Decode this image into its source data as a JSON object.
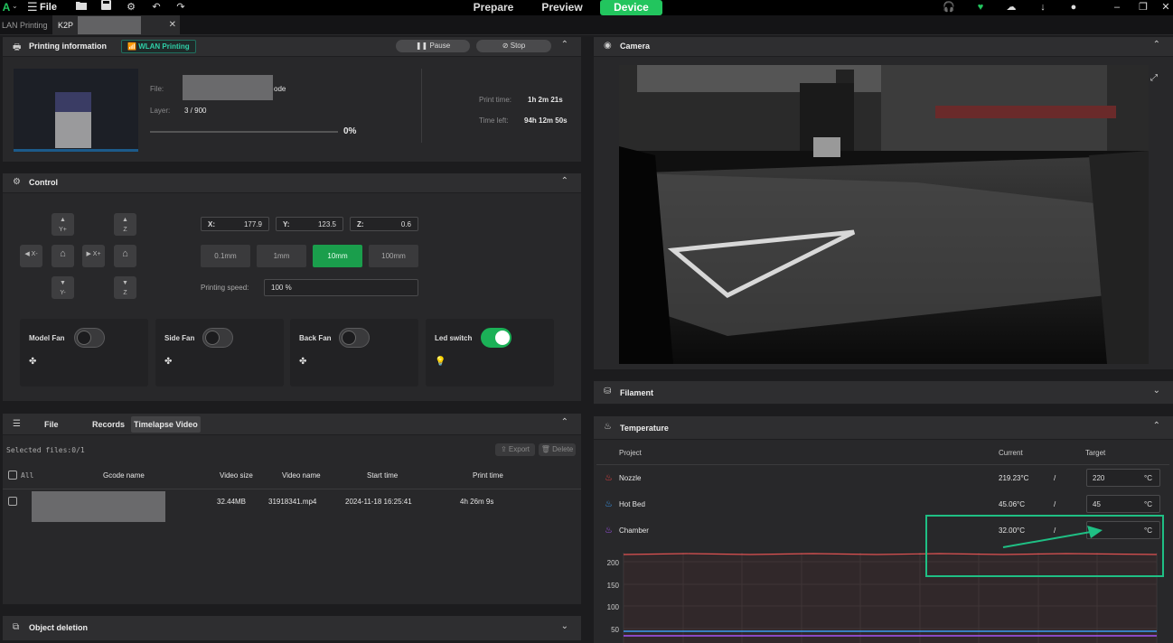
{
  "topbar": {
    "logo": "A",
    "file_menu": "File",
    "nav": {
      "prepare": "Prepare",
      "preview": "Preview",
      "device": "Device"
    }
  },
  "tabs": {
    "lan": "LAN Printing",
    "device": "K2P"
  },
  "printing_info": {
    "title": "Printing information",
    "badge": "WLAN Printing",
    "pause": "Pause",
    "stop": "Stop",
    "file_label": "File:",
    "file_suffix": "ode",
    "layer_label": "Layer:",
    "layer_value": "3 / 900",
    "progress": "0%",
    "progress_value": 0,
    "print_time_label": "Print time:",
    "print_time_value": "1h 2m 21s",
    "time_left_label": "Time left:",
    "time_left_value": "94h 12m 50s"
  },
  "control": {
    "title": "Control",
    "jog": {
      "yplus": "Y+",
      "yminus": "Y-",
      "xminus": "X-",
      "xplus": "X+",
      "z": "Z"
    },
    "coords": {
      "x_label": "X:",
      "x": "177.9",
      "y_label": "Y:",
      "y": "123.5",
      "z_label": "Z:",
      "z": "0.6"
    },
    "steps": [
      "0.1mm",
      "1mm",
      "10mm",
      "100mm"
    ],
    "speed_label": "Printing speed:",
    "speed_value": "100 %",
    "fans": [
      {
        "label": "Model Fan",
        "on": false
      },
      {
        "label": "Side Fan",
        "on": false
      },
      {
        "label": "Back Fan",
        "on": false
      },
      {
        "label": "Led switch",
        "on": true
      }
    ]
  },
  "files": {
    "tabs": [
      "File",
      "Records",
      "Timelapse Video"
    ],
    "selected": "Selected files:0/1",
    "export": "Export",
    "delete": "Delete",
    "columns": [
      "All",
      "Gcode name",
      "Video size",
      "Video name",
      "Start time",
      "Print time"
    ],
    "row": {
      "size": "32.44MB",
      "video": "31918341.mp4",
      "start": "2024-11-18 16:25:41",
      "duration": "4h 26m 9s"
    }
  },
  "object_deletion": {
    "title": "Object deletion"
  },
  "camera": {
    "title": "Camera"
  },
  "filament": {
    "title": "Filament"
  },
  "temperature": {
    "title": "Temperature",
    "columns": {
      "project": "Project",
      "current": "Current",
      "target": "Target"
    },
    "rows": [
      {
        "name": "Nozzle",
        "current": "219.23°C",
        "target": "220",
        "color": "#ef4444"
      },
      {
        "name": "Hot Bed",
        "current": "45.06°C",
        "target": "45",
        "color": "#3b9ef5"
      },
      {
        "name": "Chamber",
        "current": "32.00°C",
        "target": "",
        "color": "#a855f7"
      }
    ],
    "separator": "/",
    "unit": "°C",
    "y_ticks": [
      "200",
      "150",
      "100",
      "50"
    ],
    "colors": {
      "nozzle": "#e05252",
      "bed": "#3b9ef5",
      "chamber": "#a855f7",
      "annotation": "#1fbf84"
    }
  }
}
